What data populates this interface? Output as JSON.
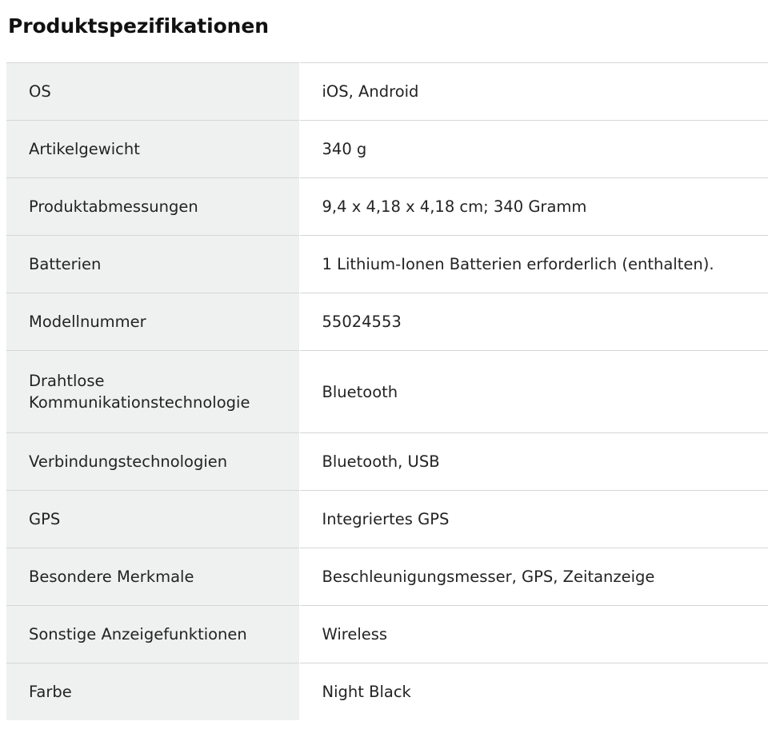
{
  "page": {
    "title": "Produktspezifikationen"
  },
  "theme": {
    "label_bg": "#eff0f0",
    "value_bg": "#ffffff",
    "divider": "#d6d6d6",
    "text": "#232323",
    "title_text": "#111111"
  },
  "spec_table": {
    "rows": [
      {
        "label": "OS",
        "value": "iOS, Android"
      },
      {
        "label": "Artikelgewicht",
        "value": "340 g"
      },
      {
        "label": "Produktabmessungen",
        "value": "9,4 x 4,18 x 4,18 cm; 340 Gramm"
      },
      {
        "label": "Batterien",
        "value": "1 Lithium-Ionen Batterien erforderlich (enthalten)."
      },
      {
        "label": "Modellnummer",
        "value": "55024553"
      },
      {
        "label": "Drahtlose Kommunikationstechnologie",
        "value": "Bluetooth"
      },
      {
        "label": "Verbindungstechnologien",
        "value": "Bluetooth, USB"
      },
      {
        "label": "GPS",
        "value": "Integriertes GPS"
      },
      {
        "label": "Besondere Merkmale",
        "value": "Beschleunigungsmesser, GPS, Zeitanzeige"
      },
      {
        "label": "Sonstige Anzeigefunktionen",
        "value": "Wireless"
      },
      {
        "label": "Farbe",
        "value": "Night Black"
      }
    ]
  }
}
